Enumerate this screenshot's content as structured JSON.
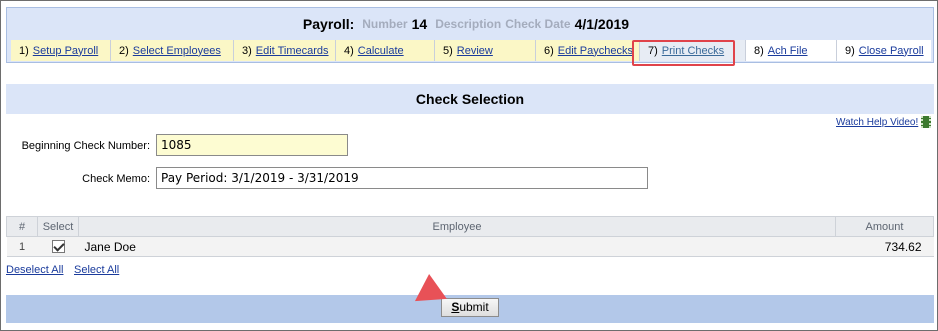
{
  "header": {
    "title": "Payroll:",
    "number_label": "Number",
    "number_value": "14",
    "description_label": "Description",
    "check_date_label": "Check Date",
    "check_date_value": "4/1/2019"
  },
  "steps": [
    {
      "num": "1)",
      "label": "Setup Payroll"
    },
    {
      "num": "2)",
      "label": "Select Employees"
    },
    {
      "num": "3)",
      "label": "Edit Timecards"
    },
    {
      "num": "4)",
      "label": "Calculate"
    },
    {
      "num": "5)",
      "label": "Review"
    },
    {
      "num": "6)",
      "label": "Edit Paychecks"
    },
    {
      "num": "7)",
      "label": "Print Checks"
    },
    {
      "num": "8)",
      "label": "Ach File"
    },
    {
      "num": "9)",
      "label": "Close Payroll"
    }
  ],
  "section": {
    "title": "Check Selection"
  },
  "help": {
    "label": "Watch Help Video!",
    "icon": "film-icon"
  },
  "form": {
    "beginning_check_label": "Beginning Check Number:",
    "beginning_check_value": "1085",
    "memo_label": "Check Memo:",
    "memo_value": "Pay Period: 3/1/2019 - 3/31/2019"
  },
  "table": {
    "headers": {
      "num": "#",
      "select": "Select",
      "employee": "Employee",
      "amount": "Amount"
    },
    "rows": [
      {
        "num": "1",
        "employee": "Jane Doe",
        "amount": "734.62",
        "checked": true
      }
    ]
  },
  "links": {
    "deselect_all": "Deselect All",
    "select_all": "Select All"
  },
  "submit": {
    "first": "S",
    "rest": "ubmit"
  },
  "colors": {
    "accent_highlight": "#e0434a",
    "header_bg": "#dbe5f8",
    "footer_bg": "#b3c8e9"
  }
}
